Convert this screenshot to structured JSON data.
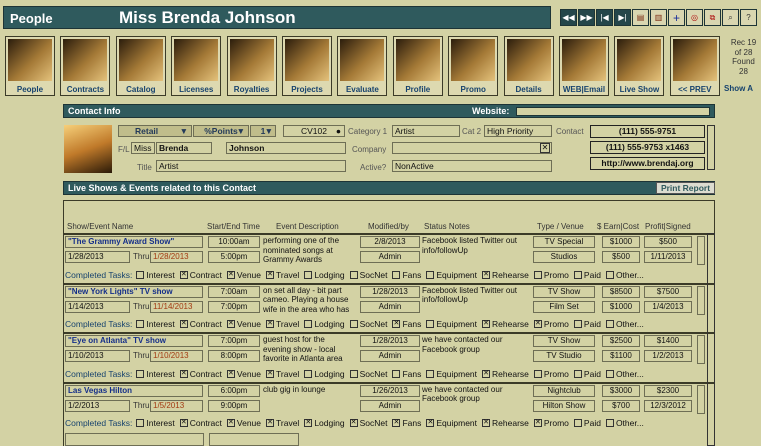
{
  "title": {
    "label": "People",
    "name": "Miss Brenda Johnson"
  },
  "nav_icons": [
    "rewind-icon",
    "fast-forward-icon",
    "skip-back-icon",
    "skip-forward-icon",
    "print-icon",
    "save-icon",
    "add-icon",
    "target-icon",
    "export-icon",
    "search-icon",
    "help-icon"
  ],
  "nav_buttons": [
    {
      "label": "People"
    },
    {
      "label": "Contracts"
    },
    {
      "label": "Catalog"
    },
    {
      "label": "Licenses"
    },
    {
      "label": "Royalties"
    },
    {
      "label": "Projects"
    },
    {
      "label": "Evaluate"
    },
    {
      "label": "Profile"
    },
    {
      "label": "Promo"
    },
    {
      "label": "Details"
    },
    {
      "label": "WEB|Email"
    },
    {
      "label": "Live Show"
    },
    {
      "label": "<< PREV"
    }
  ],
  "record": {
    "line1": "Rec 19",
    "line2": "of 28",
    "line3": "Found",
    "line4": "28",
    "show_all": "Show A"
  },
  "contact": {
    "section_label": "Contact Info",
    "website_label": "Website:",
    "website": "",
    "type": "Retail",
    "points": "%Points",
    "points_val": "1",
    "code": "CV102",
    "cat1_label": "Category 1",
    "cat1": "Artist",
    "cat2_label": "Cat 2",
    "cat2": "High Priority",
    "contact_label": "Contact",
    "phone1": "(111) 555-9751",
    "phone2": "(111) 555-9753 x1463",
    "web": "http://www.brendaj.org",
    "fl_label": "F/L",
    "salutation": "Miss",
    "first": "Brenda",
    "last": "Johnson",
    "company_label": "Company",
    "company": "",
    "title_label": "Title",
    "title_val": "Artist",
    "active_label": "Active?",
    "active": "NonActive"
  },
  "events": {
    "section_label": "Live Shows & Events related to this Contact",
    "print_button": "Print Report",
    "headers": {
      "name": "Show/Event Name",
      "time": "Start/End Time",
      "desc": "Event Description",
      "mod": "Modified/by",
      "status": "Status Notes",
      "type": "Type / Venue",
      "earn": "$ Earn|Cost",
      "profit": "Profit|Signed"
    },
    "tasks_label": "Completed Tasks:",
    "thru": "Thru",
    "task_names": [
      "Interest",
      "Contract",
      "Venue",
      "Travel",
      "Lodging",
      "SocNet",
      "Fans",
      "Equipment",
      "Rehearse",
      "Promo",
      "Paid",
      "Other..."
    ],
    "rows": [
      {
        "name": "\"The Grammy Award Show\"",
        "start_date": "1/28/2013",
        "end_date": "1/28/2013",
        "start_time": "10:00am",
        "end_time": "5:00pm",
        "description": "performing one of the nominated songs at Grammy Awards",
        "modified": "2/8/2013",
        "by": "Admin",
        "notes": "Facebook listed Twitter out info/followUp",
        "type": "TV Special",
        "venue": "Studios",
        "earn": "$1000",
        "cost": "$500",
        "profit": "$500",
        "signed": "1/11/2013",
        "checks": [
          false,
          true,
          true,
          true,
          false,
          false,
          false,
          false,
          true,
          false,
          false,
          false
        ]
      },
      {
        "name": "\"New York Lights\" TV show",
        "start_date": "1/14/2013",
        "end_date": "11/14/2013",
        "start_time": "7:00am",
        "end_time": "7:00pm",
        "description": "on set all day - bit part cameo. Playing a house wife in the area who has",
        "modified": "1/28/2013",
        "by": "Admin",
        "notes": "Facebook listed Twitter out info/followUp",
        "type": "TV Show",
        "venue": "Film Set",
        "earn": "$8500",
        "cost": "$1000",
        "profit": "$7500",
        "signed": "1/4/2013",
        "checks": [
          false,
          true,
          true,
          true,
          false,
          false,
          true,
          false,
          true,
          true,
          false,
          false
        ]
      },
      {
        "name": "\"Eye on Atlanta\" TV show",
        "start_date": "1/10/2013",
        "end_date": "1/10/2013",
        "start_time": "7:00pm",
        "end_time": "8:00pm",
        "description": "guest host for the evening show - local favorite in Atlanta area",
        "modified": "1/28/2013",
        "by": "Admin",
        "notes": "we have contacted our Facebook group",
        "type": "TV Show",
        "venue": "TV Studio",
        "earn": "$2500",
        "cost": "$1100",
        "profit": "$1400",
        "signed": "1/2/2013",
        "checks": [
          false,
          true,
          true,
          true,
          false,
          false,
          false,
          false,
          true,
          false,
          false,
          false
        ]
      },
      {
        "name": "Las Vegas Hilton",
        "start_date": "1/2/2013",
        "end_date": "1/5/2013",
        "start_time": "6:00pm",
        "end_time": "9:00pm",
        "description": "club gig in lounge",
        "modified": "1/26/2013",
        "by": "Admin",
        "notes": "we have contacted our Facebook group",
        "type": "Nightclub",
        "venue": "Hilton Show",
        "earn": "$3000",
        "cost": "$700",
        "profit": "$2300",
        "signed": "12/3/2012",
        "checks": [
          false,
          true,
          true,
          true,
          true,
          true,
          true,
          true,
          true,
          true,
          false,
          false
        ]
      }
    ]
  }
}
